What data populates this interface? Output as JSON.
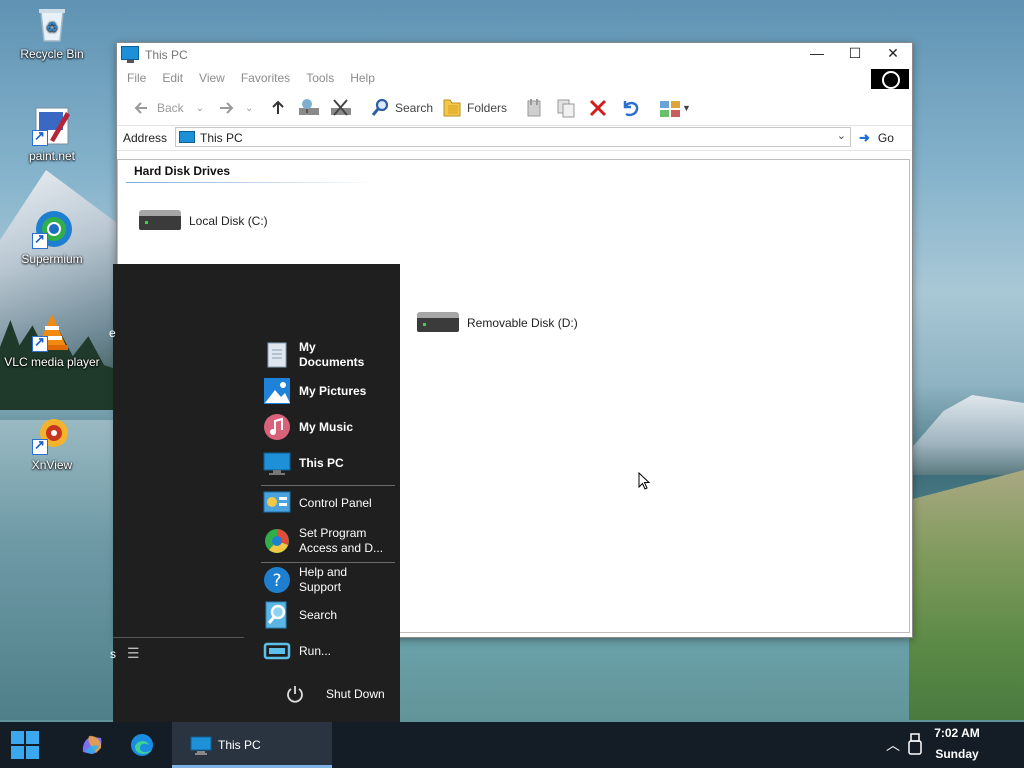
{
  "desktop": {
    "icons": [
      {
        "label": "Recycle Bin",
        "icon": "recycle-bin-icon"
      },
      {
        "label": "paint.net",
        "icon": "paint-net-icon"
      },
      {
        "label": "Supermium",
        "icon": "supermium-icon"
      },
      {
        "label": "VLC media player",
        "icon": "vlc-icon"
      },
      {
        "label": "XnView",
        "icon": "xnview-icon"
      }
    ]
  },
  "window": {
    "title": "This PC",
    "controls": {
      "minimize": "—",
      "maximize": "☐",
      "close": "✕"
    },
    "menu": [
      "File",
      "Edit",
      "View",
      "Favorites",
      "Tools",
      "Help"
    ],
    "toolbar": {
      "back": "Back",
      "search": "Search",
      "folders": "Folders"
    },
    "address": {
      "label": "Address",
      "value": "This PC",
      "go": "Go"
    },
    "group_header": "Hard Disk Drives",
    "drives": [
      {
        "label": "Local Disk (C:)"
      },
      {
        "label": "Removable Disk (D:)"
      }
    ]
  },
  "start_menu": {
    "items": [
      {
        "label": "My Documents"
      },
      {
        "label": "My Pictures"
      },
      {
        "label": "My Music"
      },
      {
        "label": "This PC"
      },
      {
        "label": "Control Panel"
      },
      {
        "label": "Set Program Access and D..."
      },
      {
        "label": "Help and Support"
      },
      {
        "label": "Search"
      },
      {
        "label": "Run..."
      }
    ],
    "shutdown": "Shut Down",
    "left_partial_top": "e",
    "left_partial_bottom": "s"
  },
  "taskbar": {
    "task": "This PC",
    "time": "7:02 AM",
    "day": "Sunday"
  },
  "colors": {
    "accent": "#1e90d8",
    "taskbar": "#141d26",
    "startmenu": "#1f1f1f"
  }
}
